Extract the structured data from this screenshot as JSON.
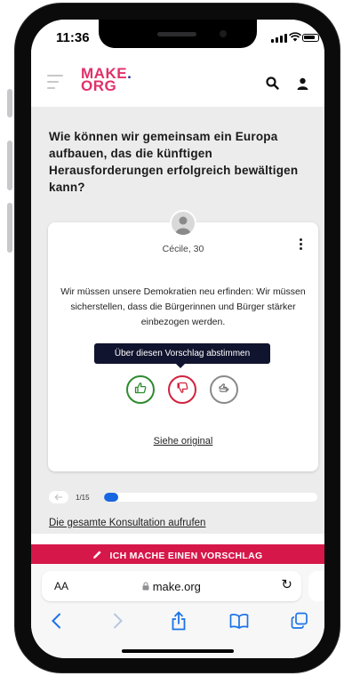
{
  "status": {
    "time": "11:36"
  },
  "header": {
    "logo_line1_a": "MAKE",
    "logo_line1_b": ".",
    "logo_line2": "ORG"
  },
  "question": "Wie können wir gemeinsam ein Europa aufbauen, das die künftigen Herausforderungen erfolgreich bewältigen kann?",
  "card": {
    "author": "Cécile, 30",
    "proposal": "Wir müssen unsere Demokratien neu erfinden: Wir müssen sicherstellen, dass die Bürgerinnen und Bürger stärker einbezogen werden.",
    "tooltip": "Über diesen Vorschlag abstimmen",
    "original_link": "Siehe original"
  },
  "pager": {
    "count": "1/15",
    "progress": 0.067
  },
  "all_consultation_link": "Die gesamte Konsultation aufrufen",
  "cta": {
    "label": "ICH MACHE EINEN VORSCHLAG"
  },
  "safari": {
    "aa": "AA",
    "url": "make.org"
  },
  "colors": {
    "brand_red": "#e0316a",
    "brand_blue": "#262e8a",
    "cta": "#d6174a",
    "agree": "#2e8b2e",
    "disagree": "#d2223e",
    "progress": "#1866e0"
  }
}
